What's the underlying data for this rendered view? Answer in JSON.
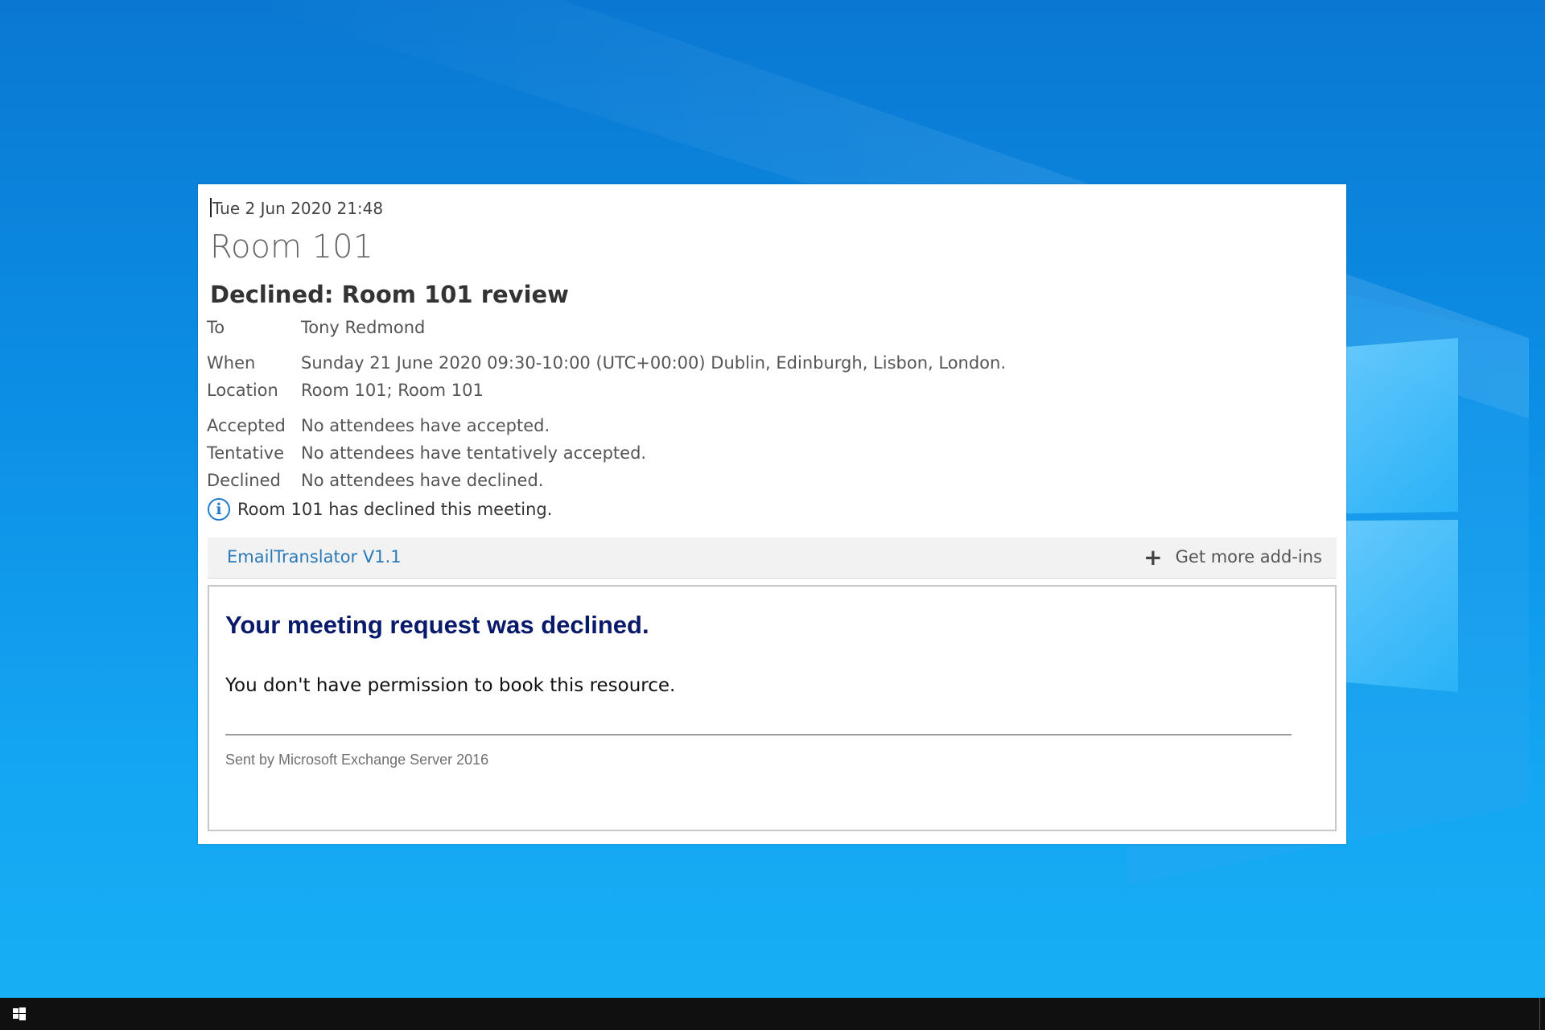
{
  "message": {
    "date": "Tue 2 Jun 2020 21:48",
    "organizer": "Room 101",
    "subject": "Declined: Room 101 review",
    "fields": [
      {
        "label": "To",
        "value": "Tony Redmond"
      },
      {
        "label": "When",
        "value": "Sunday 21 June 2020 09:30-10:00 (UTC+00:00) Dublin, Edinburgh, Lisbon, London."
      },
      {
        "label": "Location",
        "value": "Room 101; Room 101"
      },
      {
        "label": "Accepted",
        "value": "No attendees have accepted."
      },
      {
        "label": "Tentative",
        "value": "No attendees have tentatively accepted."
      },
      {
        "label": "Declined",
        "value": "No attendees have declined."
      }
    ],
    "info": "Room 101 has declined this meeting.",
    "info_icon": "info-icon"
  },
  "addins": {
    "name": "EmailTranslator V1.1",
    "get_more": "Get more add-ins"
  },
  "body": {
    "title": "Your meeting request was declined.",
    "message": "You don't have permission to book this resource.",
    "footer": "Sent by Microsoft Exchange Server 2016"
  },
  "taskbar": {
    "start_icon": "windows-logo-icon"
  },
  "colors": {
    "title_navy": "#0a1a6b",
    "link_blue": "#2a7ab8",
    "desktop_blue": "#0c8fe6"
  }
}
